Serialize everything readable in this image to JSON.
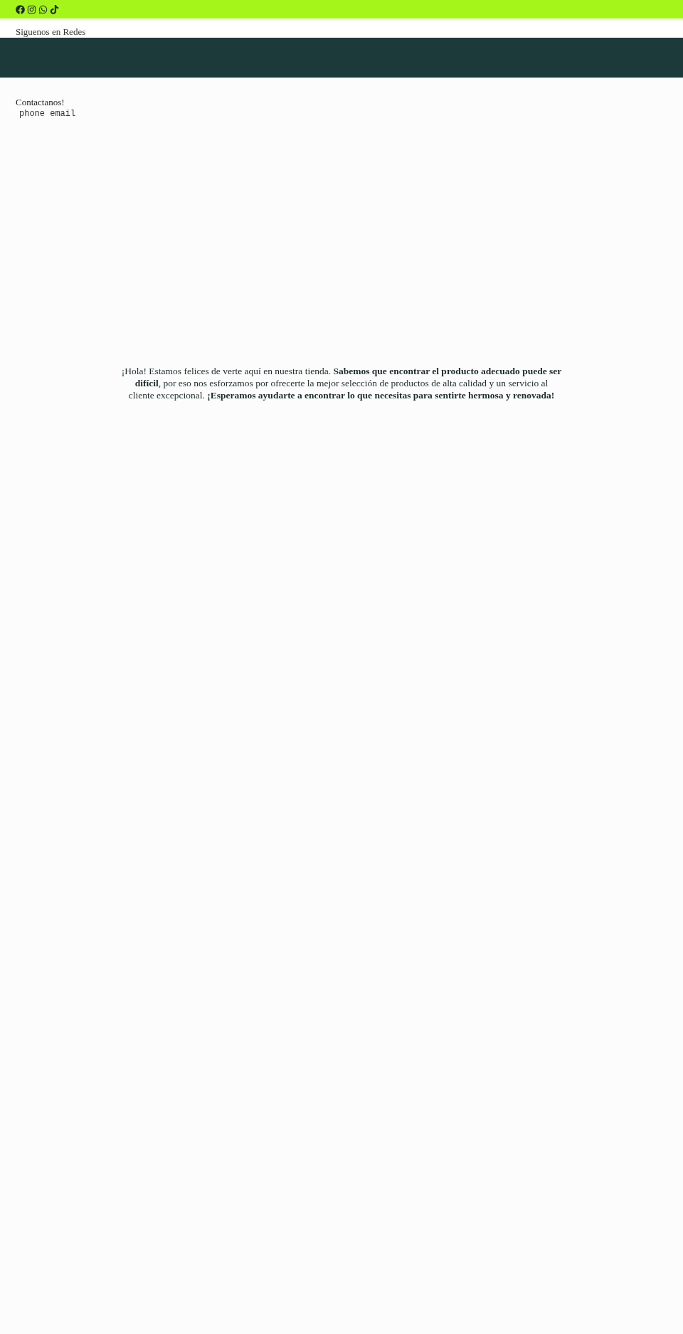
{
  "social_bar": {
    "icons": [
      {
        "kind": "facebook"
      },
      {
        "kind": "instagram"
      },
      {
        "kind": "whatsapp"
      },
      {
        "kind": "tiktok"
      }
    ]
  },
  "follow_label": "Siguenos en Redes",
  "contact": {
    "title": "Contactanos!",
    "links": "phone email"
  },
  "welcome": "¡Hola! Estamos felices de verte aquí en nuestra tienda. **Sabemos que encontrar el producto adecuado puede ser difícil**, por eso nos esforzamos por ofrecerte la mejor selección de productos de alta calidad y un servicio al cliente excepcional. **¡Esperamos ayudarte a encontrar lo que necesitas para sentirte hermosa y renovada!**"
}
